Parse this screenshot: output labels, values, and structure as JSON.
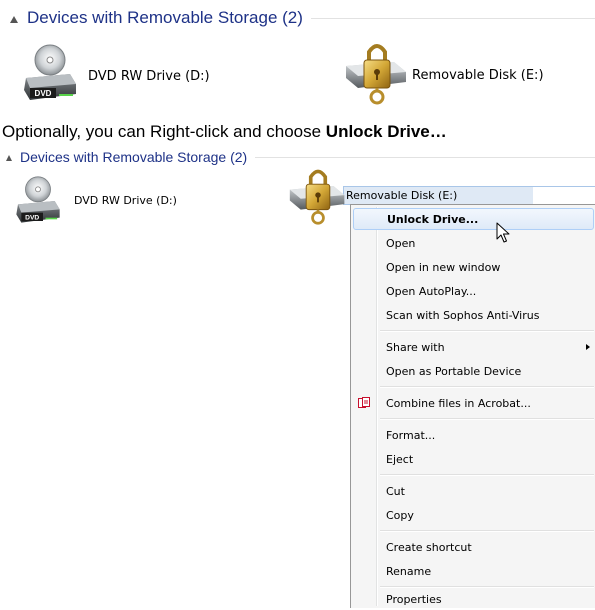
{
  "panel1": {
    "group_title": "Devices with Removable Storage (2)",
    "drives": [
      {
        "label": "DVD RW Drive (D:)",
        "icon": "dvd-drive-icon",
        "badge": "DVD"
      },
      {
        "label": "Removable Disk (E:)",
        "icon": "locked-drive-icon"
      }
    ]
  },
  "caption": {
    "prefix": "Optionally, you can Right-click and choose ",
    "bold": "Unlock Drive…"
  },
  "panel2": {
    "group_title": "Devices with Removable Storage (2)",
    "drives": [
      {
        "label": "DVD RW Drive (D:)",
        "icon": "dvd-drive-icon",
        "badge": "DVD"
      },
      {
        "label": "Removable Disk (E:)",
        "icon": "locked-drive-icon"
      }
    ]
  },
  "context_menu": {
    "items": [
      {
        "label": "Unlock Drive...",
        "bold": true,
        "highlighted": true
      },
      {
        "label": "Open"
      },
      {
        "label": "Open in new window"
      },
      {
        "label": "Open AutoPlay..."
      },
      {
        "label": "Scan with Sophos Anti-Virus"
      },
      {
        "label": "Share with",
        "submenu": true
      },
      {
        "label": "Open as Portable Device"
      },
      {
        "label": "Combine files in Acrobat...",
        "icon": "acrobat-icon"
      },
      {
        "label": "Format..."
      },
      {
        "label": "Eject"
      },
      {
        "label": "Cut"
      },
      {
        "label": "Copy"
      },
      {
        "label": "Create shortcut"
      },
      {
        "label": "Rename"
      },
      {
        "label": "Properties"
      }
    ]
  },
  "colors": {
    "group_title": "#1e3287",
    "menu_background": "#f5f5f5",
    "highlight_border": "#aecff7",
    "selection_fill": "#dfe9f5"
  }
}
